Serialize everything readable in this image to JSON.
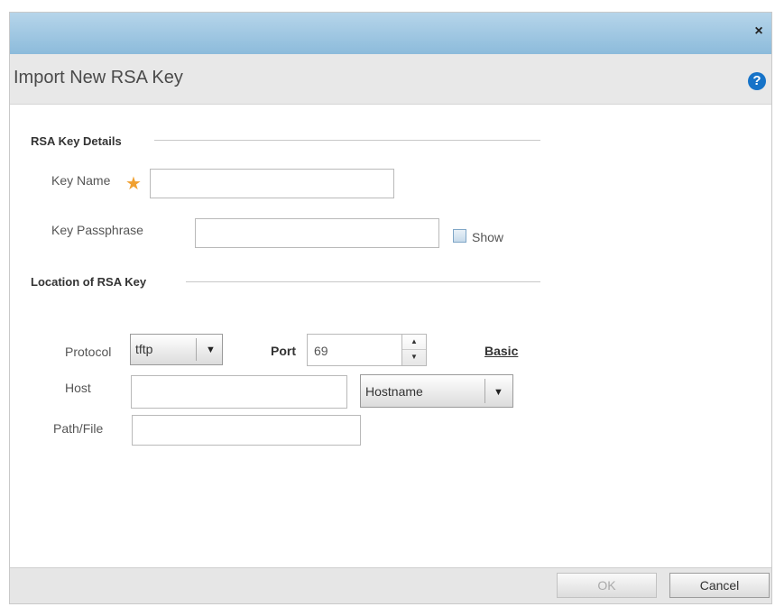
{
  "dialog": {
    "close_symbol": "×",
    "title": "Import New RSA Key",
    "help_symbol": "?"
  },
  "details": {
    "section_title": "RSA Key Details",
    "key_name_label": "Key Name",
    "required_symbol": "★",
    "key_name_value": "",
    "key_passphrase_label": "Key Passphrase",
    "key_passphrase_value": "",
    "show_label": "Show"
  },
  "location": {
    "section_title": "Location of RSA Key",
    "protocol_label": "Protocol",
    "protocol_value": "tftp",
    "port_label": "Port",
    "port_value": "69",
    "basic_link": "Basic",
    "host_label": "Host",
    "host_value": "",
    "host_type_value": "Hostname",
    "path_label": "Path/File",
    "path_value": ""
  },
  "footer": {
    "ok_label": "OK",
    "cancel_label": "Cancel"
  },
  "icons": {
    "dropdown_arrow": "▼",
    "spin_up": "▲",
    "spin_down": "▼"
  },
  "colors": {
    "titlebar": "#8cbbdb",
    "required": "#f0a030",
    "help": "#1673c8"
  }
}
